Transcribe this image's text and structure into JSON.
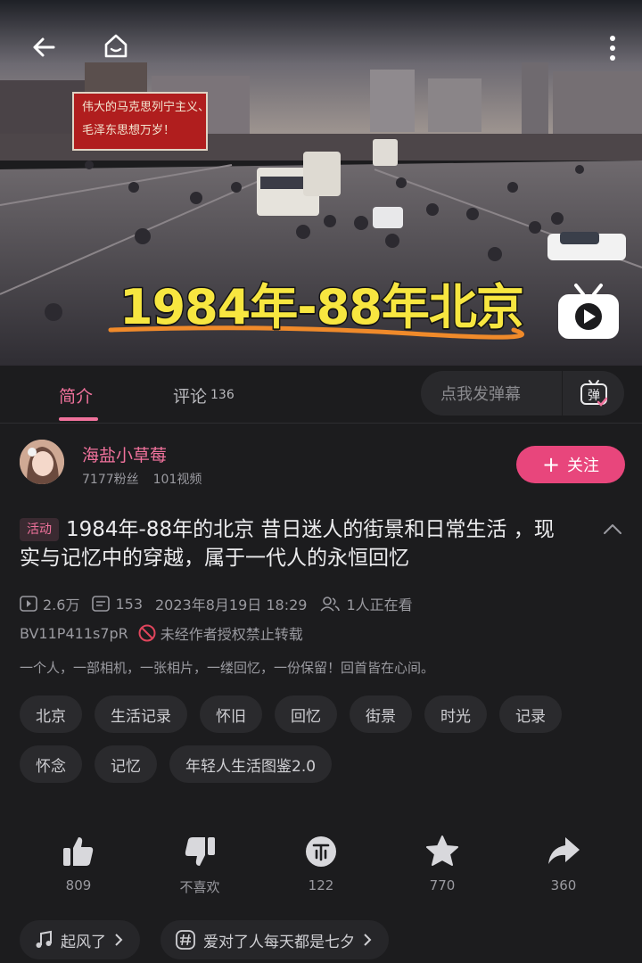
{
  "video": {
    "caption": "1984年-88年北京",
    "poster_line1": "伟大的马克思列宁主义、",
    "poster_line2": "毛泽东思想万岁！"
  },
  "tabs": [
    {
      "label": "简介"
    },
    {
      "label": "评论",
      "count": "136"
    }
  ],
  "danmaku": {
    "placeholder": "点我发弹幕",
    "button_glyph": "弹"
  },
  "author": {
    "name": "海盐小草莓",
    "fans": "7177粉丝",
    "videos": "101视频",
    "follow_label": "关注"
  },
  "video_info": {
    "badge": "活动",
    "title": "1984年-88年的北京   昔日迷人的街景和日常生活 ，现实与记忆中的穿越，属于一代人的永恒回忆",
    "views": "2.6万",
    "danmaku_count": "153",
    "date": "2023年8月19日 18:29",
    "watching": "1人正在看",
    "bvid": "BV11P411s7pR",
    "copyright": "未经作者授权禁止转载",
    "description": "一个人，一部相机，一张相片，一缕回忆，一份保留！回首皆在心间。"
  },
  "tags": [
    "北京",
    "生活记录",
    "怀旧",
    "回忆",
    "街景",
    "时光",
    "记录",
    "怀念",
    "记忆",
    "年轻人生活图鉴2.0"
  ],
  "actions": {
    "like": "809",
    "dislike": "不喜欢",
    "coin": "122",
    "favorite": "770",
    "share": "360"
  },
  "chips": {
    "music": "起风了",
    "topic": "爱对了人每天都是七夕"
  },
  "colors": {
    "accent": "#f0729c",
    "follow": "#e8467c",
    "caption": "#f7e640",
    "background": "#1c1c1e"
  }
}
